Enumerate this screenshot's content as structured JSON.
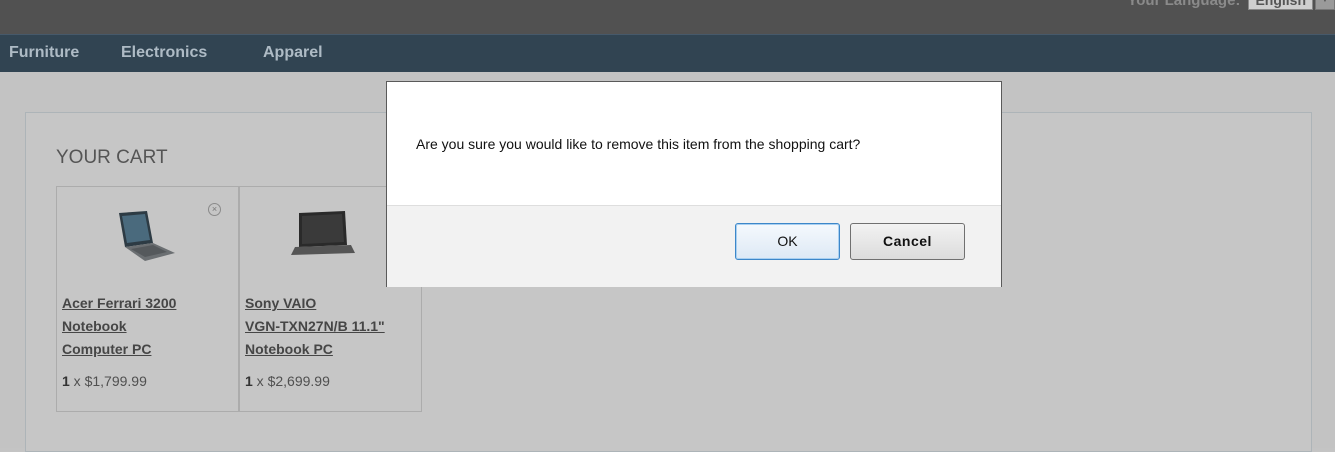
{
  "header": {
    "language_label": "Your Language:",
    "language_value": "English"
  },
  "nav": {
    "items": [
      "Furniture",
      "Electronics",
      "Apparel"
    ]
  },
  "cart": {
    "title": "YOUR CART",
    "items": [
      {
        "name": "Acer Ferrari 3200\nNotebook\nComputer PC",
        "qty": "1",
        "price": " x $1,799.99"
      },
      {
        "name": "Sony VAIO\nVGN-TXN27N/B 11.1\"\nNotebook PC",
        "qty": "1",
        "price": " x $2,699.99"
      }
    ]
  },
  "dialog": {
    "message": "Are you sure you would like to remove this item from the shopping cart?",
    "ok_label": "OK",
    "cancel_label": "Cancel"
  }
}
